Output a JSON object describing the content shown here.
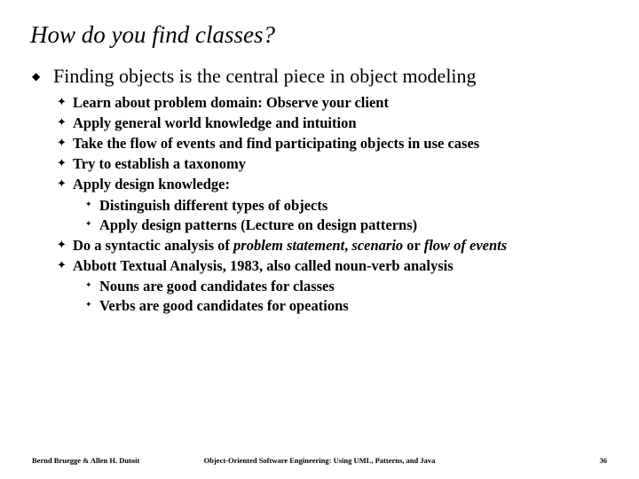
{
  "title": "How do you find classes?",
  "lvl1": "Finding objects is the central piece in object modeling",
  "b2": {
    "a": "Learn about problem domain: Observe your client",
    "b": "Apply general world knowledge and intuition",
    "c": "Take the flow of events and find participating objects in use cases",
    "d": "Try to establish a taxonomy",
    "e": "Apply design knowledge:"
  },
  "b3a": {
    "a": "Distinguish different types of objects",
    "b": "Apply design patterns (Lecture on design patterns)"
  },
  "syntactic": {
    "prefix": "Do a syntactic analysis ",
    "of": "of ",
    "ps": "problem statement",
    "sep1": ",  ",
    "sc": "scenario",
    "sep2": "  or ",
    "fe": "flow of events"
  },
  "abbott": "Abbott Textual Analysis, 1983, also called noun-verb analysis",
  "b3b": {
    "a": "Nouns are good candidates for classes",
    "b": "Verbs are good candidates for opeations"
  },
  "footer": {
    "left": "Bernd Bruegge & Allen H. Dutoit",
    "center": "Object-Oriented Software Engineering: Using UML, Patterns, and Java",
    "right": "36"
  }
}
